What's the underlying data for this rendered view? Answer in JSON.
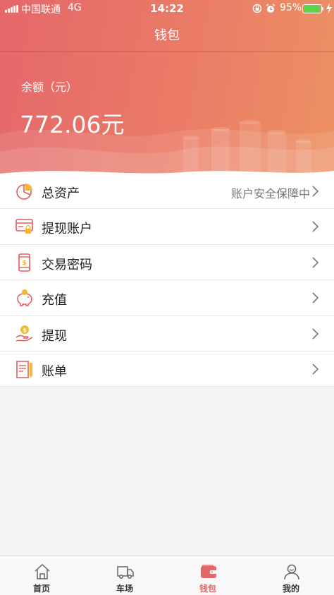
{
  "status_bar": {
    "carrier": "中国联通",
    "network": "4G",
    "time": "14:22",
    "battery_percent": "95%",
    "battery_level": 0.95,
    "battery_color": "#5fd34a"
  },
  "header": {
    "title": "钱包"
  },
  "balance": {
    "label": "余额（元）",
    "amount": "772.06元"
  },
  "menu": {
    "items": [
      {
        "label": "总资产",
        "note": "账户安全保障中",
        "icon": "pie-chart-icon"
      },
      {
        "label": "提现账户",
        "icon": "card-lock-icon"
      },
      {
        "label": "交易密码",
        "icon": "phone-dollar-icon"
      },
      {
        "label": "充值",
        "icon": "piggy-bank-icon"
      },
      {
        "label": "提现",
        "icon": "hand-coin-icon"
      },
      {
        "label": "账单",
        "icon": "bill-icon"
      }
    ]
  },
  "tabbar": {
    "tabs": [
      {
        "label": "首页",
        "icon": "home-icon",
        "active": false
      },
      {
        "label": "车场",
        "icon": "truck-icon",
        "active": false
      },
      {
        "label": "钱包",
        "icon": "wallet-icon",
        "active": true
      },
      {
        "label": "我的",
        "icon": "user-icon",
        "active": false
      }
    ]
  },
  "colors": {
    "accent": "#e5676a",
    "icon_red": "#e85a5a",
    "icon_yellow": "#f5b830"
  }
}
